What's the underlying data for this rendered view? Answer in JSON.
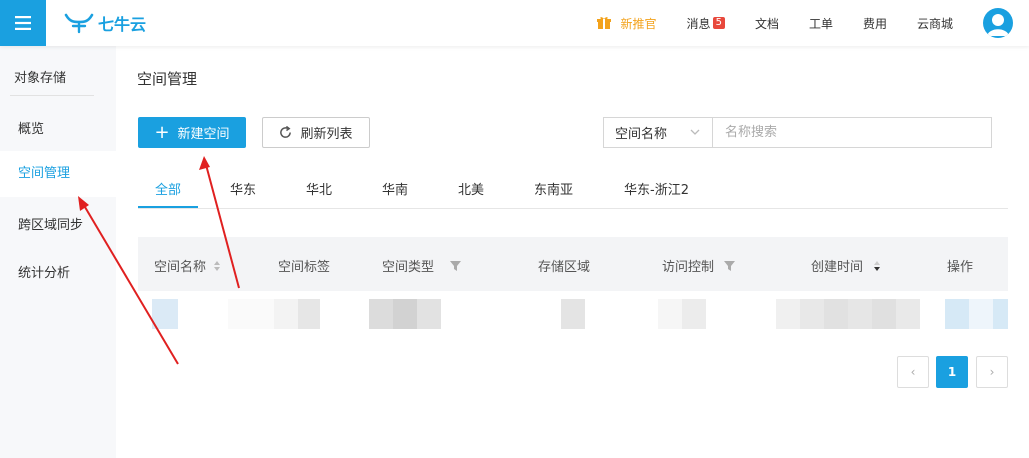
{
  "header": {
    "logo_text": "七牛云",
    "nav": {
      "promo": "新推官",
      "messages": "消息",
      "message_count": "5",
      "docs": "文档",
      "tickets": "工单",
      "billing": "费用",
      "marketplace": "云商城"
    }
  },
  "sidebar": {
    "title": "对象存储",
    "items": [
      {
        "label": "概览"
      },
      {
        "label": "空间管理"
      },
      {
        "label": "跨区域同步"
      },
      {
        "label": "统计分析"
      }
    ]
  },
  "main": {
    "title": "空间管理",
    "new_bucket_label": "新建空间",
    "refresh_label": "刷新列表",
    "search": {
      "select_value": "空间名称",
      "placeholder": "名称搜索"
    },
    "tabs": [
      "全部",
      "华东",
      "华北",
      "华南",
      "北美",
      "东南亚",
      "华东-浙江2"
    ],
    "table": {
      "columns": [
        "空间名称",
        "空间标签",
        "空间类型",
        "存储区域",
        "访问控制",
        "创建时间",
        "操作"
      ]
    },
    "pagination": {
      "current_page": "1",
      "prev": "‹",
      "next": "›"
    }
  },
  "colors": {
    "accent": "#1aa0e0",
    "badge": "#e8483c",
    "promo": "#f3a21b",
    "annotation_arrow": "#e02020"
  },
  "icons": [
    "menu-icon",
    "qiniu-logo-icon",
    "gift-icon",
    "user-avatar-icon",
    "plus-icon",
    "refresh-icon",
    "chevron-down-icon",
    "sort-icon",
    "filter-icon"
  ]
}
